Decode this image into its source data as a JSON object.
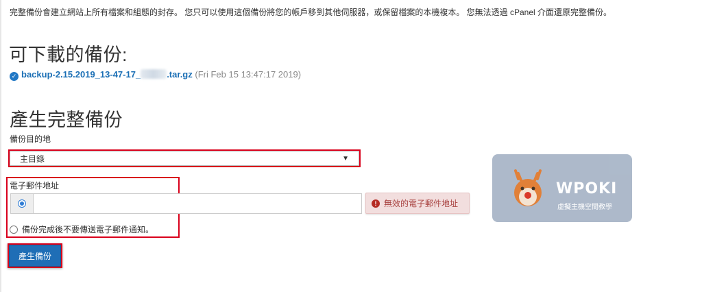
{
  "intro_text": "完整備份會建立網站上所有檔案和組態的封存。 您只可以使用這個備份將您的帳戶移到其他伺服器，或保留檔案的本機複本。 您無法透過 cPanel 介面還原完整備份。",
  "downloads": {
    "heading": "可下載的備份:",
    "backup_file_prefix": "backup-2.15.2019_13-47-17_",
    "backup_file_suffix": ".tar.gz",
    "backup_date": "(Fri Feb 15 13:47:17 2019)"
  },
  "generate": {
    "heading": "產生完整備份",
    "destination_label": "備份目的地",
    "destination_value": "主目錄",
    "email_label": "電子郵件地址",
    "email_value": "",
    "error_text": "無效的電子郵件地址",
    "no_email_label": "備份完成後不要傳送電子郵件通知。",
    "submit_label": "產生備份"
  },
  "watermark": {
    "brand": "WPOKI",
    "tagline": "虛擬主機空間教學"
  },
  "colors": {
    "link": "#1b6fb5",
    "highlight_border": "#d9001b",
    "primary_button": "#1f6eb6",
    "error_bg": "#f2dede"
  }
}
